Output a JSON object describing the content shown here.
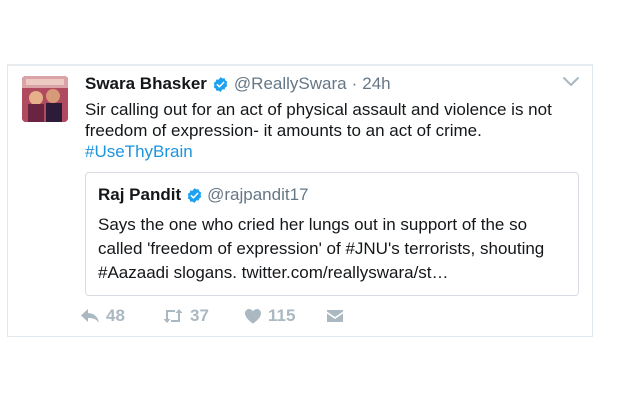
{
  "tweet": {
    "display_name": "Swara Bhasker",
    "handle": "@ReallySwara",
    "separator": "·",
    "time": "24h",
    "text": "Sir calling out for an act of physical assault and violence is not freedom of expression- it amounts to an act of crime.",
    "hashtag": "#UseThyBrain"
  },
  "quoted": {
    "display_name": "Raj Pandit",
    "handle": "@rajpandit17",
    "text": "Says the one who cried her lungs out in support of the so called 'freedom of expression' of #JNU's terrorists, shouting #Aazaadi slogans. twitter.com/reallyswara/st…"
  },
  "actions": {
    "reply_count": "48",
    "retweet_count": "37",
    "like_count": "115"
  },
  "icons": {
    "verified": "verified-badge-icon",
    "menu": "chevron-down-icon",
    "reply": "reply-icon",
    "retweet": "retweet-icon",
    "like": "heart-icon",
    "dm": "envelope-icon"
  },
  "colors": {
    "verified": "#1da1f2",
    "hashtag": "#1b95e0",
    "muted": "#657786",
    "action": "#aab8c2"
  }
}
